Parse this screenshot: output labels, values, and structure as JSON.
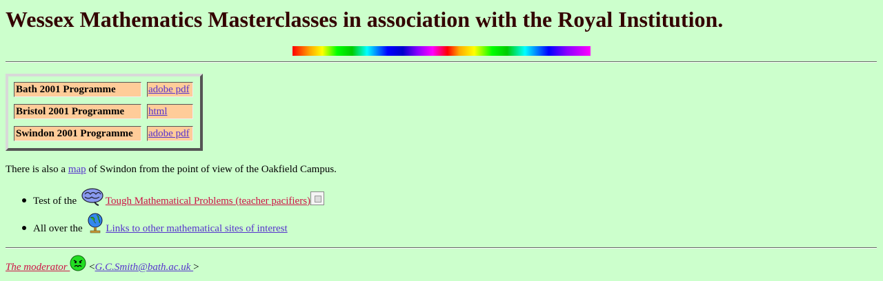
{
  "page": {
    "title": "Wessex Mathematics Masterclasses in association with the Royal Institution."
  },
  "programmes": [
    {
      "name": "Bath 2001 Programme",
      "link": "adobe pdf"
    },
    {
      "name": "Bristol 2001 Programme",
      "link": "html"
    },
    {
      "name": "Swindon 2001 Programme",
      "link": "adobe pdf"
    }
  ],
  "map_para": {
    "before": "There is also a ",
    "link": "map",
    "after": " of Swindon from the point of view of the Oakfield Campus."
  },
  "bullets": {
    "item1_prefix": "Test of the ",
    "item1_link": "Tough Mathematical Problems (teacher pacifiers)",
    "item1_icon": "brain-icon",
    "item2_prefix": "All over the ",
    "item2_link": "Links to other mathematical sites of interest",
    "item2_icon": "globe-icon"
  },
  "footer": {
    "moderator_link": "The moderator ",
    "open": " <",
    "email": "G.C.Smith@bath.ac.uk ",
    "close": ">",
    "face_icon": "angry-face-icon"
  },
  "colors": {
    "background": "#ccffcc",
    "title": "#330000",
    "cell": "#ffcc99",
    "link": "#5533cc",
    "visited_link": "#cc1144"
  }
}
